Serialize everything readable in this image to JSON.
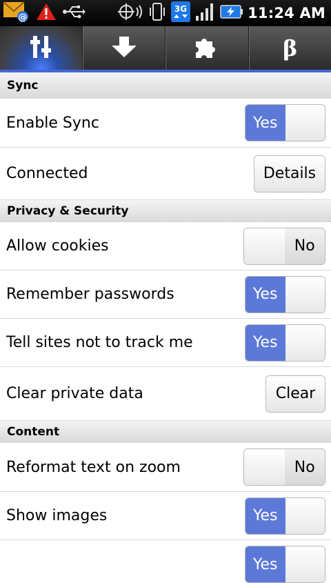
{
  "status_bar": {
    "time": "11:24 AM",
    "network": "3G",
    "icons": [
      "email-alert-icon",
      "warning-icon",
      "usb-icon",
      "gps-icon",
      "vibrate-icon",
      "network-3g-icon",
      "signal-icon",
      "battery-charging-icon"
    ],
    "colors": {
      "warning": "#e0201a",
      "email": "#e7a51f",
      "battery": "#1e78e6"
    }
  },
  "tabs": [
    {
      "name": "settings",
      "icon": "sliders-icon",
      "active": true
    },
    {
      "name": "downloads",
      "icon": "download-arrow-icon",
      "active": false
    },
    {
      "name": "addons",
      "icon": "puzzle-piece-icon",
      "active": false
    },
    {
      "name": "beta",
      "icon": "beta-icon",
      "label": "β",
      "active": false
    }
  ],
  "accent_color": "#5d79d8",
  "sections": {
    "sync": {
      "title": "Sync",
      "enable_sync": {
        "label": "Enable Sync",
        "value": "Yes"
      },
      "connected": {
        "label": "Connected",
        "button": "Details"
      }
    },
    "privacy": {
      "title": "Privacy & Security",
      "allow_cookies": {
        "label": "Allow cookies",
        "value": "No"
      },
      "remember_passwords": {
        "label": "Remember passwords",
        "value": "Yes"
      },
      "do_not_track": {
        "label": "Tell sites not to track me",
        "value": "Yes"
      },
      "clear_data": {
        "label": "Clear private data",
        "button": "Clear"
      }
    },
    "content": {
      "title": "Content",
      "reformat_text": {
        "label": "Reformat text on zoom",
        "value": "No"
      },
      "show_images": {
        "label": "Show images",
        "value": "Yes"
      },
      "next_row": {
        "value": "Yes"
      }
    }
  }
}
